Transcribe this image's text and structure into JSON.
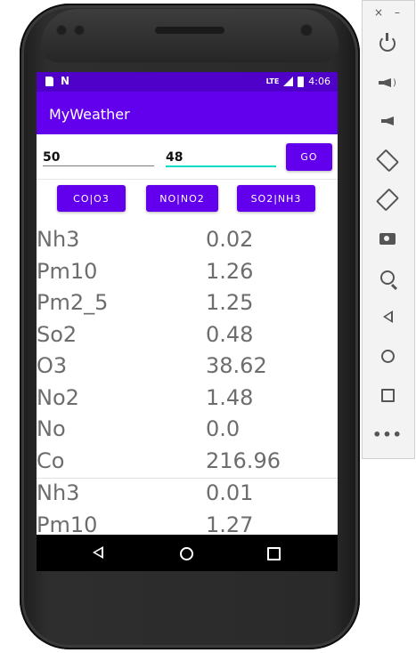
{
  "status_bar": {
    "time": "4:06",
    "network": "LTE"
  },
  "app_bar": {
    "title": "MyWeather"
  },
  "inputs": {
    "field1_value": "50",
    "field2_value": "48",
    "go_label": "GO"
  },
  "pollutant_buttons": [
    {
      "label": "CO|O3"
    },
    {
      "label": "NO|NO2"
    },
    {
      "label": "SO2|NH3"
    }
  ],
  "readings": [
    {
      "name": "Nh3",
      "value": "0.02"
    },
    {
      "name": "Pm10",
      "value": "1.26"
    },
    {
      "name": "Pm2_5",
      "value": "1.25"
    },
    {
      "name": "So2",
      "value": "0.48"
    },
    {
      "name": "O3",
      "value": "38.62"
    },
    {
      "name": "No2",
      "value": "1.48"
    },
    {
      "name": "No",
      "value": "0.0"
    },
    {
      "name": "Co",
      "value": "216.96"
    },
    {
      "name": "Nh3",
      "value": "0.01"
    },
    {
      "name": "Pm10",
      "value": "1.27"
    }
  ],
  "colors": {
    "primary": "#6200ee",
    "primary_dark": "#4f00c9",
    "accent": "#03dac5"
  },
  "emulator_toolbar": {
    "icons": [
      "power-icon",
      "volume-up-icon",
      "volume-down-icon",
      "rotate-left-icon",
      "rotate-right-icon",
      "screenshot-icon",
      "zoom-icon",
      "back-icon",
      "home-icon",
      "overview-icon",
      "more-icon"
    ]
  }
}
